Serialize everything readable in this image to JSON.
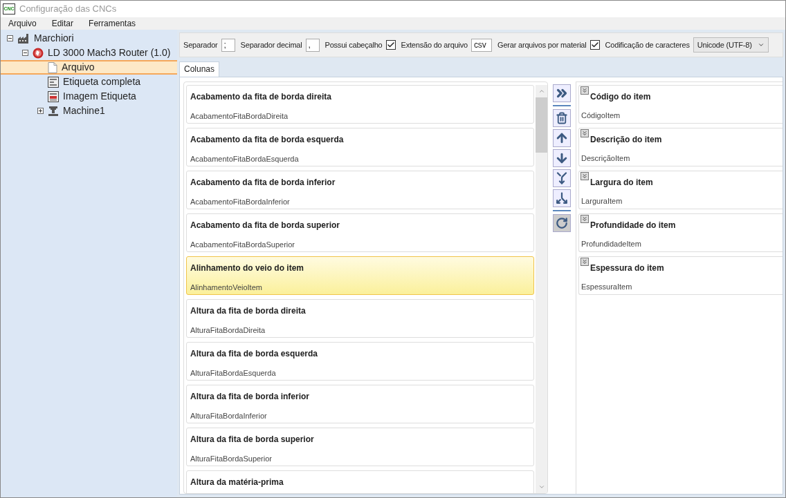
{
  "window": {
    "title": "Configuração das CNCs",
    "icon_text": "CNC"
  },
  "menu": [
    "Arquivo",
    "Editar",
    "Ferramentas"
  ],
  "tree": [
    {
      "label": "Marchiori",
      "kind": "factory",
      "expanded": true,
      "selected": false,
      "children": [
        {
          "label": "LD 3000 Mach3 Router (1.0)",
          "kind": "machine",
          "expanded": true,
          "selected": false,
          "children": [
            {
              "label": "Arquivo",
              "kind": "file",
              "selected": true
            },
            {
              "label": "Etiqueta completa",
              "kind": "label",
              "selected": false
            },
            {
              "label": "Imagem Etiqueta",
              "kind": "image-label",
              "selected": false
            },
            {
              "label": "Machine1",
              "kind": "router",
              "expanded": false,
              "selected": false
            }
          ]
        }
      ]
    }
  ],
  "toolbar": [
    {
      "kind": "input",
      "label": "Separador",
      "value": ";"
    },
    {
      "kind": "input",
      "label": "Separador decimal",
      "value": ","
    },
    {
      "kind": "checkbox",
      "label": "Possui cabeçalho",
      "checked": true
    },
    {
      "kind": "input",
      "label": "Extensão do arquivo",
      "value": "csv"
    },
    {
      "kind": "checkbox",
      "label": "Gerar arquivos por material",
      "checked": true
    },
    {
      "kind": "select",
      "label": "Codificação de caracteres",
      "value": "Unicode (UTF-8)"
    }
  ],
  "tabs": [
    {
      "label": "Colunas",
      "selected": true
    }
  ],
  "available_columns": [
    {
      "title": "Acabamento da fita de borda direita",
      "key": "AcabamentoFitaBordaDireita",
      "selected": false
    },
    {
      "title": "Acabamento da fita de borda esquerda",
      "key": "AcabamentoFitaBordaEsquerda",
      "selected": false
    },
    {
      "title": "Acabamento da fita de borda inferior",
      "key": "AcabamentoFitaBordaInferior",
      "selected": false
    },
    {
      "title": "Acabamento da fita de borda superior",
      "key": "AcabamentoFitaBordaSuperior",
      "selected": false
    },
    {
      "title": "Alinhamento do veio do item",
      "key": "AlinhamentoVeioItem",
      "selected": true
    },
    {
      "title": "Altura da fita de borda direita",
      "key": "AlturaFitaBordaDireita",
      "selected": false
    },
    {
      "title": "Altura da fita de borda esquerda",
      "key": "AlturaFitaBordaEsquerda",
      "selected": false
    },
    {
      "title": "Altura da fita de borda inferior",
      "key": "AlturaFitaBordaInferior",
      "selected": false
    },
    {
      "title": "Altura da fita de borda superior",
      "key": "AlturaFitaBordaSuperior",
      "selected": false
    },
    {
      "title": "Altura da matéria-prima",
      "selected": false
    }
  ],
  "selected_columns": [
    {
      "title": "Código do item",
      "key": "CódigoItem"
    },
    {
      "title": "Descrição do item",
      "key": "DescriçãoItem"
    },
    {
      "title": "Largura do item",
      "key": "LarguraItem"
    },
    {
      "title": "Profundidade do item",
      "key": "ProfundidadeItem"
    },
    {
      "title": "Espessura do item",
      "key": "EspessuraItem"
    }
  ]
}
